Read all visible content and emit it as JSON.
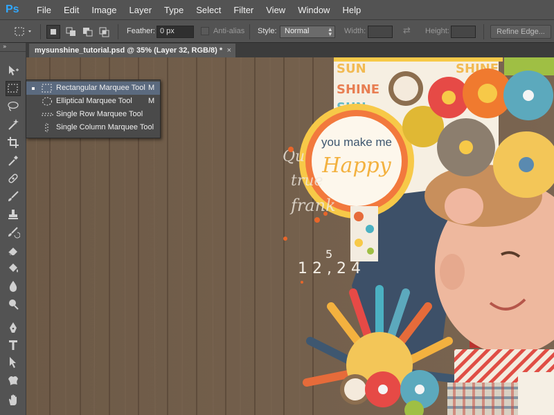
{
  "app": {
    "logo": "Ps",
    "menu": [
      "File",
      "Edit",
      "Image",
      "Layer",
      "Type",
      "Select",
      "Filter",
      "View",
      "Window",
      "Help"
    ]
  },
  "options": {
    "feather_label": "Feather:",
    "feather_value": "0 px",
    "antialias_label": "Anti-alias",
    "style_label": "Style:",
    "style_value": "Normal",
    "width_label": "Width:",
    "height_label": "Height:",
    "refine_edge": "Refine Edge..."
  },
  "document": {
    "tab_title": "mysunshine_tutorial.psd @ 35% (Layer 32, RGB/8) *",
    "close_glyph": "×"
  },
  "flyout": {
    "items": [
      {
        "label": "Rectangular Marquee Tool",
        "shortcut": "M",
        "selected": true,
        "icon": "rectangle-marquee-icon"
      },
      {
        "label": "Elliptical Marquee Tool",
        "shortcut": "M",
        "selected": false,
        "icon": "ellipse-marquee-icon"
      },
      {
        "label": "Single Row Marquee Tool",
        "shortcut": "",
        "selected": false,
        "icon": "single-row-marquee-icon"
      },
      {
        "label": "Single Column Marquee Tool",
        "shortcut": "",
        "selected": false,
        "icon": "single-column-marquee-icon"
      }
    ]
  },
  "artwork": {
    "sticker_line1": "you make me",
    "sticker_line2": "Happy",
    "paper_text_1": "SUN",
    "paper_text_2": "SHINE",
    "numbers": "1 2 , 2 4",
    "numbers_top": "5",
    "script_text_1": "Qu",
    "script_text_2": "true",
    "script_text_3": "frank"
  },
  "colors": {
    "ui_dark": "#535353",
    "wood": "#6f5b48",
    "selection": "#5b6a7f",
    "ps_blue": "#31a8ff"
  }
}
